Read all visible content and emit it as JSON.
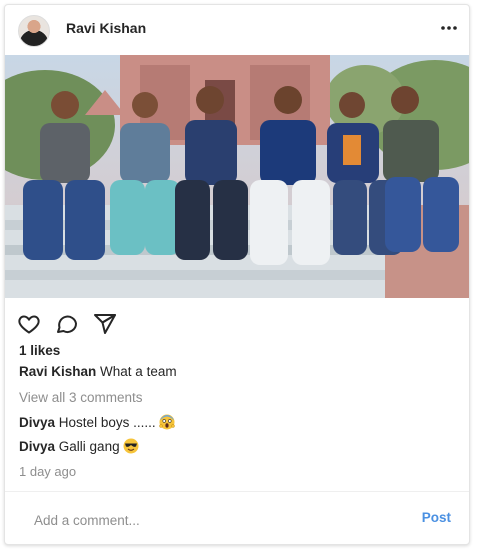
{
  "post": {
    "username": "Ravi Kishan",
    "more_icon": "more-horizontal-icon",
    "image_alt": "Group of six friends sitting on temple steps",
    "actions": {
      "like_icon": "heart-icon",
      "comment_icon": "comment-bubble-icon",
      "share_icon": "send-icon"
    },
    "likes_text": "1 likes",
    "caption": {
      "username": "Ravi Kishan",
      "text": "What a team"
    },
    "view_all_comments": "View all 3 comments",
    "comments": [
      {
        "username": "Divya",
        "text": "Hostel boys ......",
        "emoji": "screaming-face-emoji"
      },
      {
        "username": "Divya",
        "text": "Galli gang",
        "emoji": "sunglasses-face-emoji"
      }
    ],
    "timestamp": "1 day ago",
    "add_comment": {
      "placeholder": "Add a comment...",
      "value": ""
    },
    "post_button": "Post",
    "colors": {
      "post_button": "#4a90e2",
      "muted_text": "#8e8e8e"
    }
  }
}
